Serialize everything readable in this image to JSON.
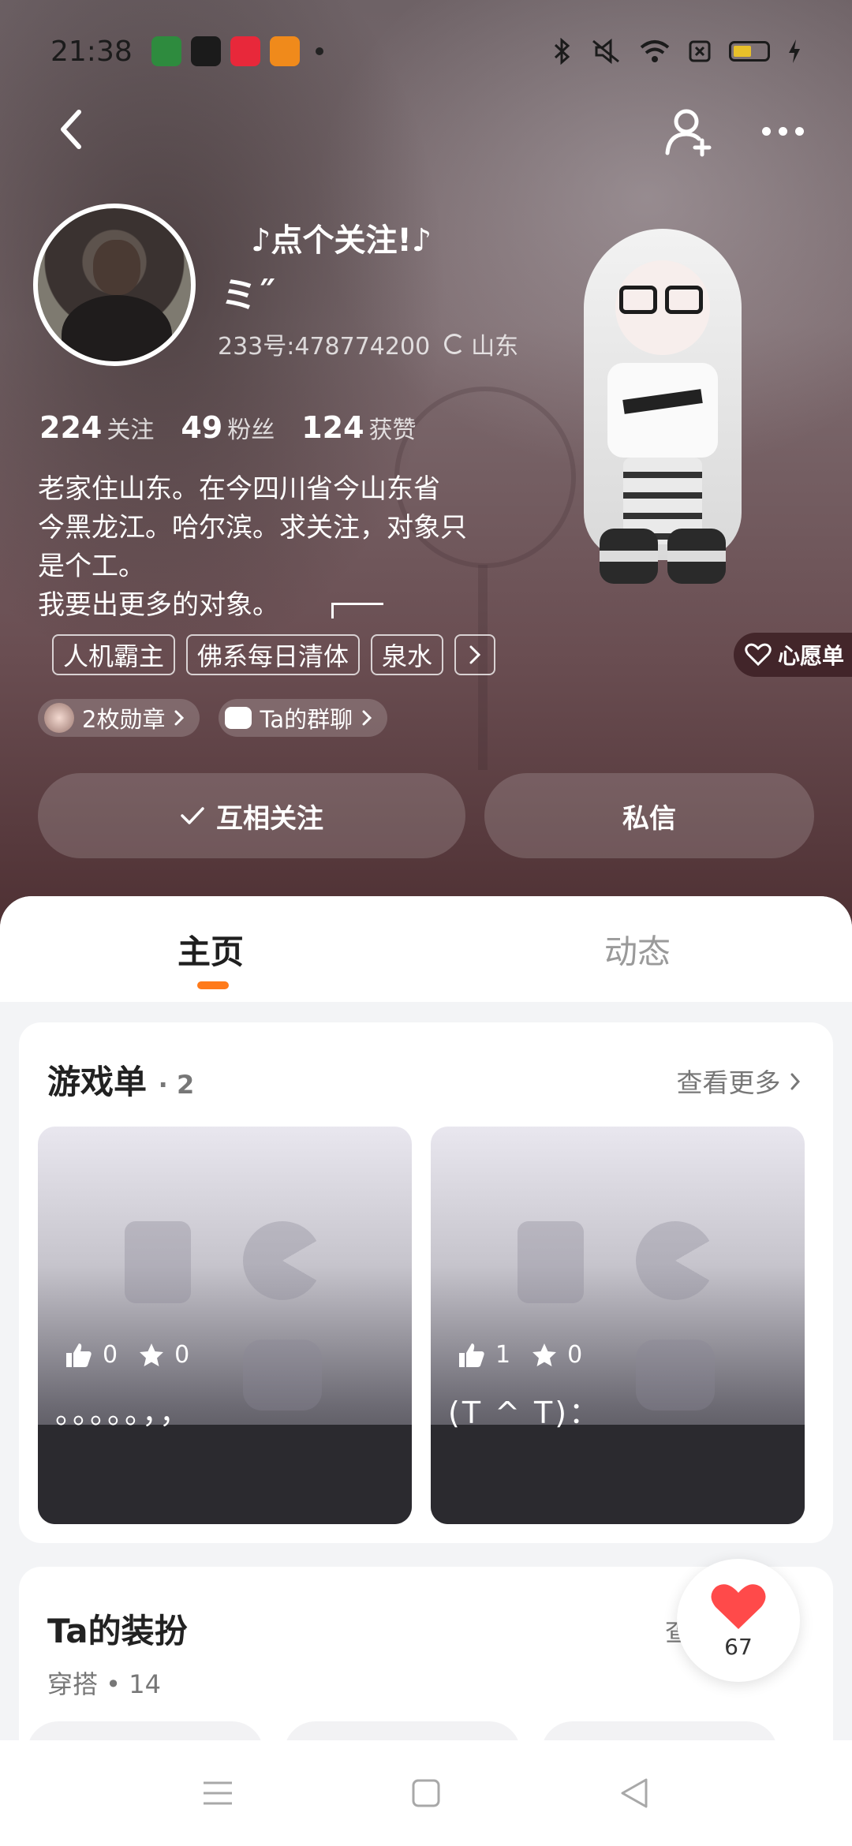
{
  "status_bar": {
    "time": "21:38",
    "apps": [
      {
        "name": "oppo-app",
        "color": "#2e8b3e"
      },
      {
        "name": "tiktok-app",
        "color": "#1b1b1b"
      },
      {
        "name": "xiaohongshu-app",
        "color": "#e8283a"
      },
      {
        "name": "orange-app",
        "color": "#f08a1b"
      }
    ],
    "icons": [
      "bluetooth-icon",
      "mute-icon",
      "wifi-icon",
      "nfc-icon",
      "battery-icon",
      "charging-icon"
    ]
  },
  "profile": {
    "tagline": "♪点个关注!♪",
    "nickname": "ミ˝",
    "id_text": "233号:478774200",
    "location": "山东",
    "stats": [
      {
        "value": "224",
        "label": "关注"
      },
      {
        "value": "49",
        "label": "粉丝"
      },
      {
        "value": "124",
        "label": "获赞"
      }
    ],
    "bio_lines": [
      "老家住山东。在今四川省今山东省",
      "今黑龙江。哈尔滨。求关注，对象只",
      "是个工。",
      "我要出更多的对象。"
    ],
    "tags": [
      "人机霸主",
      "佛系每日清体",
      "泉水"
    ],
    "wishlist_label": "心愿单",
    "badge_chip": "2枚勋章",
    "group_chip": "Ta的群聊",
    "follow_button": "互相关注",
    "message_button": "私信"
  },
  "tabs": [
    {
      "label": "主页",
      "active": true
    },
    {
      "label": "动态",
      "active": false
    }
  ],
  "game_list": {
    "title": "游戏单",
    "count": "· 2",
    "see_more": "查看更多",
    "items": [
      {
        "likes": "0",
        "stars": "0",
        "title": "。。。。。，，"
      },
      {
        "likes": "1",
        "stars": "0",
        "title": "(T ^ T)："
      }
    ]
  },
  "outfit": {
    "title": "Ta的装扮",
    "subtitle": "穿搭 • 14",
    "see_more": "查"
  },
  "like_float": {
    "count": "67",
    "color": "#ff4a4a"
  },
  "colors": {
    "accent": "#ff7a1a"
  }
}
